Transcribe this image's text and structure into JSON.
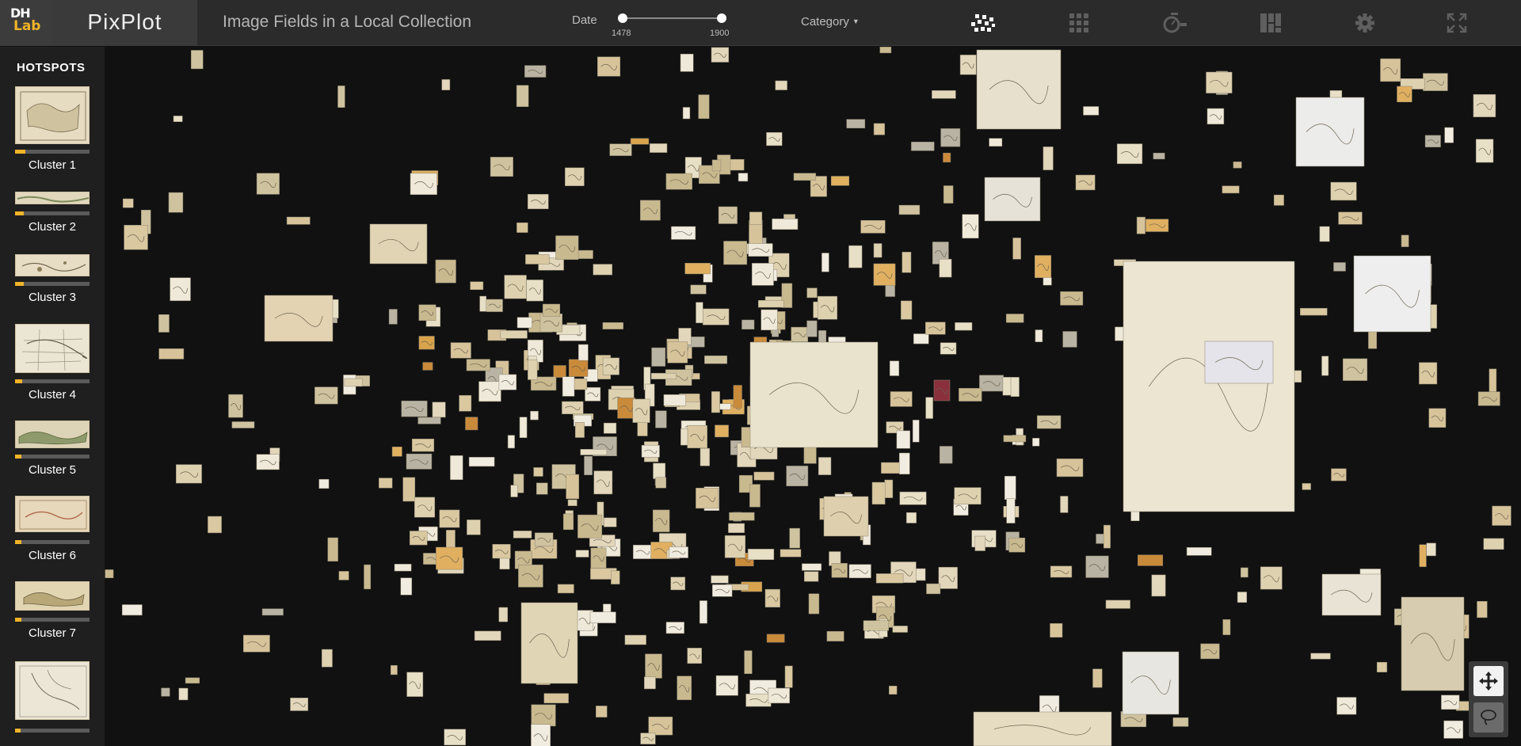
{
  "header": {
    "logo_top": "DH",
    "logo_bottom": "Lab",
    "app_name": "PixPlot",
    "page_title": "Image Fields in a Local Collection"
  },
  "date_filter": {
    "label": "Date",
    "min": "1478",
    "max": "1900"
  },
  "category_filter": {
    "label": "Category"
  },
  "toolbar": {
    "active_tool": "umap-layout",
    "icons": [
      "umap-layout-icon",
      "grid-layout-icon",
      "date-layout-icon",
      "categorical-layout-icon",
      "settings-icon",
      "fullscreen-icon"
    ]
  },
  "sidebar": {
    "title": "HOTSPOTS",
    "clusters": [
      {
        "label": "Cluster 1",
        "progress": 0.14
      },
      {
        "label": "Cluster 2",
        "progress": 0.12
      },
      {
        "label": "Cluster 3",
        "progress": 0.12
      },
      {
        "label": "Cluster 4",
        "progress": 0.1
      },
      {
        "label": "Cluster 5",
        "progress": 0.08
      },
      {
        "label": "Cluster 6",
        "progress": 0.08
      },
      {
        "label": "Cluster 7",
        "progress": 0.08
      },
      {
        "label": "",
        "progress": 0.07
      }
    ]
  },
  "nav_controls": {
    "pan": "pan-icon",
    "lasso": "lasso-icon"
  },
  "colors": {
    "background": "#111111",
    "header": "#2b2b2b",
    "sidebar": "#1f1f1f",
    "accent": "#f0b429",
    "parchment": "#e8dfc7"
  }
}
